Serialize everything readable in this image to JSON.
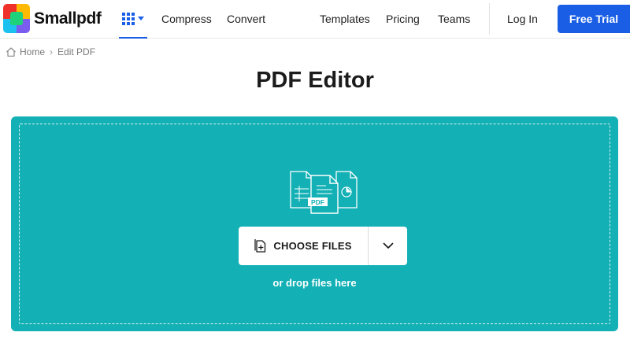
{
  "header": {
    "logo_text": "Smallpdf",
    "nav": {
      "compress": "Compress",
      "convert": "Convert",
      "templates": "Templates",
      "pricing": "Pricing",
      "teams": "Teams",
      "login": "Log In"
    },
    "trial_label": "Free Trial"
  },
  "breadcrumb": {
    "home": "Home",
    "separator": "›",
    "current": "Edit PDF"
  },
  "page_title": "PDF Editor",
  "dropzone": {
    "illustration_label": "PDF",
    "choose_label": "CHOOSE FILES",
    "drop_text": "or drop files here"
  },
  "colors": {
    "accent": "#1a5ee6",
    "dropzone": "#13b0b5"
  }
}
